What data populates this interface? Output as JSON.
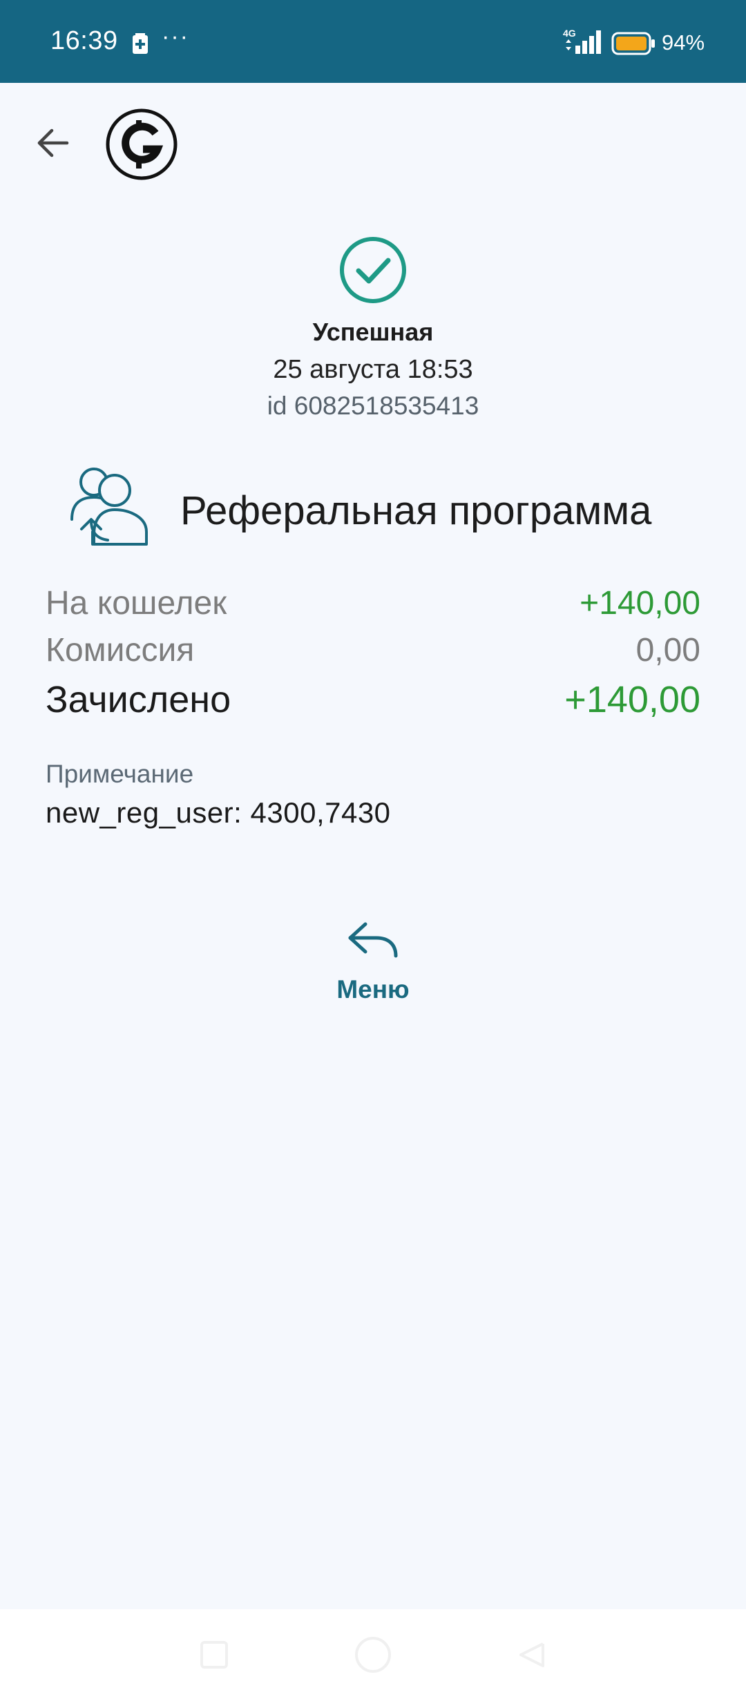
{
  "status_bar": {
    "time": "16:39",
    "overflow": "···",
    "network": "4G",
    "battery": "94%"
  },
  "header": {
    "back_icon": "arrow-left-icon",
    "logo_icon": "coin-logo-icon"
  },
  "transaction": {
    "status": "Успешная",
    "date": "25 августа 18:53",
    "id": "id 6082518535413",
    "type_icon": "referral-users-icon",
    "type": "Реферальная программа",
    "rows": [
      {
        "label": "На кошелек",
        "value": "+140,00"
      },
      {
        "label": "Комиссия",
        "value": "0,00"
      },
      {
        "label": "Зачислено",
        "value": "+140,00"
      }
    ],
    "note_label": "Примечание",
    "note_value": "new_reg_user: 4300,7430"
  },
  "actions": {
    "menu_label": "Меню",
    "menu_icon": "reply-arrow-icon"
  },
  "colors": {
    "status_bar": "#156683",
    "background": "#f5f8fd",
    "accent": "#1a6a80",
    "success": "#1e9a86",
    "positive_amount": "#2d9a36"
  }
}
